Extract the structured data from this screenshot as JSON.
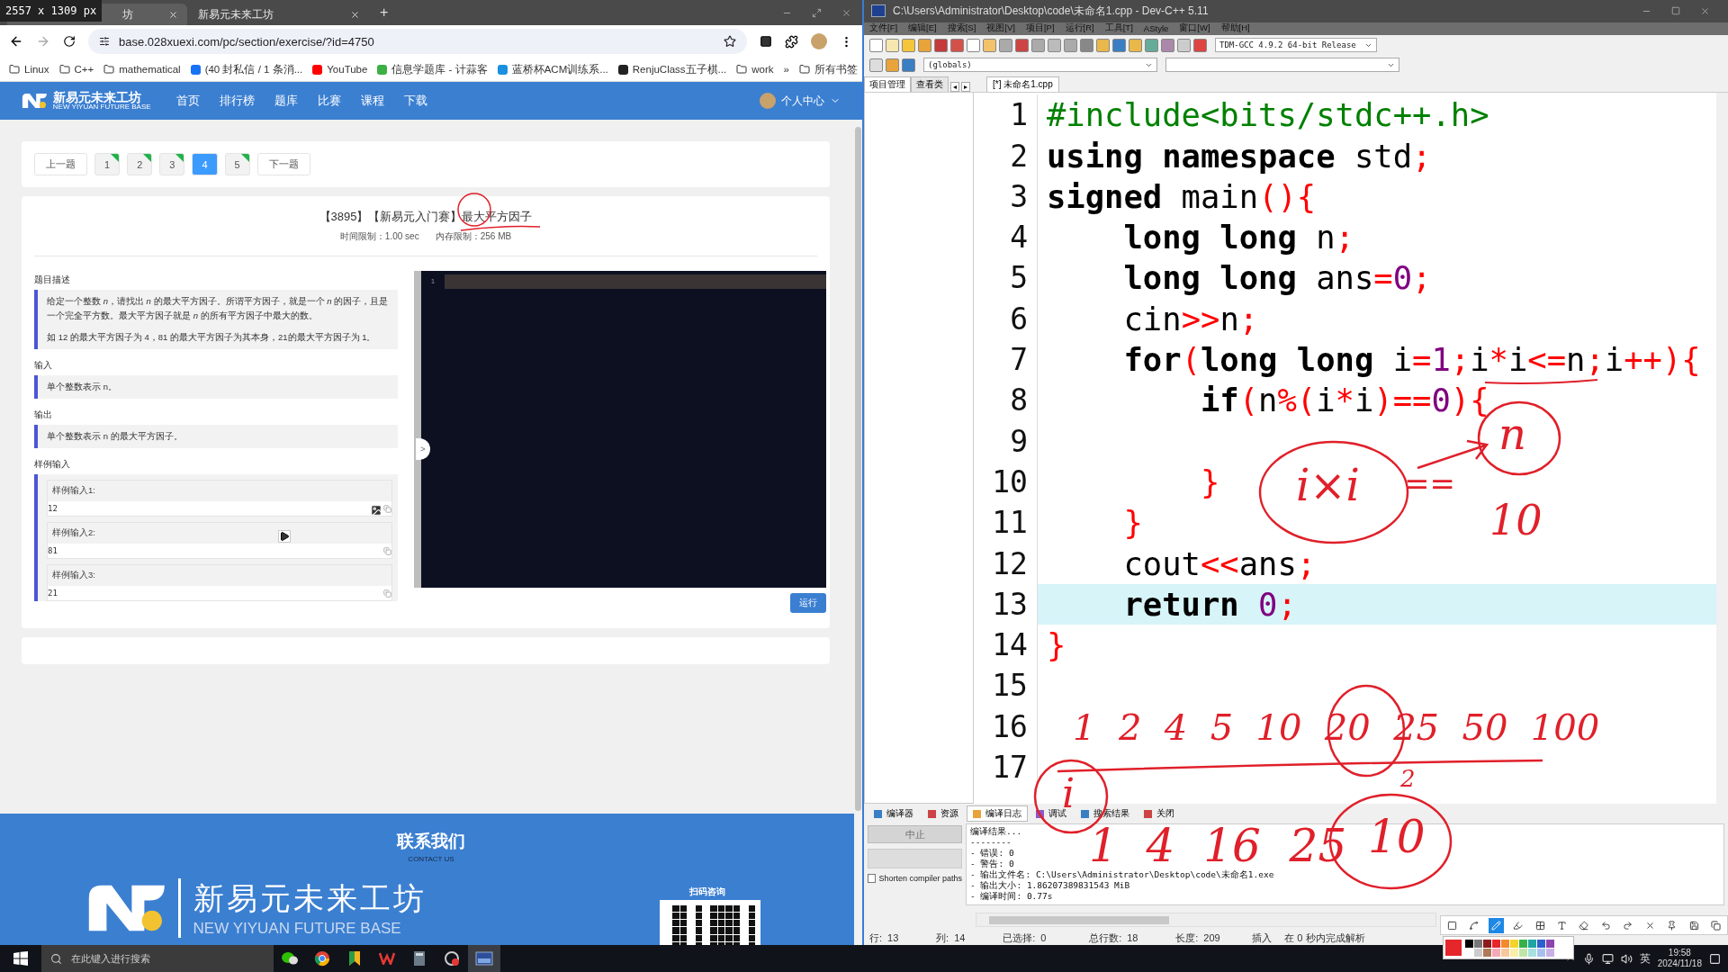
{
  "overlay_label": "2557 x 1309 px",
  "browser": {
    "tabs": [
      {
        "title": "坊",
        "selected": true
      },
      {
        "title": "新易元未来工坊",
        "selected": false
      }
    ],
    "new_tab": "+",
    "url": "base.028xuexi.com/pc/section/exercise/?id=4750",
    "bookmarks": [
      {
        "label": "Linux",
        "kind": "folder"
      },
      {
        "label": "C++",
        "kind": "folder"
      },
      {
        "label": "mathematical",
        "kind": "folder"
      },
      {
        "label": "(40 封私信 / 1 条消...",
        "kind": "zhihu"
      },
      {
        "label": "YouTube",
        "kind": "youtube"
      },
      {
        "label": "信息学题库 - 计蒜客",
        "kind": "jisuanke"
      },
      {
        "label": "蓝桥杯ACM训练系...",
        "kind": "lanqiao"
      },
      {
        "label": "RenjuClass五子棋...",
        "kind": "renju"
      },
      {
        "label": "work",
        "kind": "folder"
      }
    ],
    "bookmarks_more": "»",
    "all_bookmarks": "所有书签",
    "site": {
      "logo_title": "新易元未来工坊",
      "logo_subtitle": "NEW YIYUAN FUTURE BASE",
      "nav": [
        "首页",
        "排行榜",
        "题库",
        "比赛",
        "课程",
        "下载"
      ],
      "user": "个人中心"
    },
    "pager": {
      "prev": "上一题",
      "next": "下一题",
      "pages": [
        {
          "label": "1",
          "selected": false,
          "done": true
        },
        {
          "label": "2",
          "selected": false,
          "done": true
        },
        {
          "label": "3",
          "selected": false,
          "done": true
        },
        {
          "label": "4",
          "selected": true,
          "done": false
        },
        {
          "label": "5",
          "selected": false,
          "done": true
        }
      ]
    },
    "problem": {
      "title": "【3895】【新易元入门赛】最大平方因子",
      "meta": [
        "时间限制：1.00 sec",
        "内存限制：256 MB"
      ],
      "sections": [
        {
          "heading": "题目描述",
          "paragraphs": [
            "给定一个整数 *n*，请找出 *n* 的最大平方因子。所谓平方因子，就是一个 *n* 的因子，且是一个完全平方数。最大平方因子就是 *n* 的所有平方因子中最大的数。",
            "如 12 的最大平方因子为 4，81 的最大平方因子为其本身，21的最大平方因子为 1。"
          ]
        },
        {
          "heading": "输入",
          "paragraphs": [
            "单个整数表示 n。"
          ]
        },
        {
          "heading": "输出",
          "paragraphs": [
            "单个整数表示 n 的最大平方因子。"
          ]
        }
      ],
      "samples_heading": "样例输入",
      "samples": [
        {
          "label": "样例输入1:",
          "value": "12"
        },
        {
          "label": "样例输入2:",
          "value": "81"
        },
        {
          "label": "样例输入3:",
          "value": "21"
        }
      ]
    },
    "editor": {
      "line_numbers": [
        "1"
      ],
      "toggle": ">",
      "run": "运行"
    },
    "footer": {
      "title": "联系我们",
      "subtitle": "CONTACT US",
      "logo_title": "新易元未来工坊",
      "logo_subtitle": "NEW YIYUAN FUTURE BASE",
      "qr_label": "扫码咨询"
    }
  },
  "devcpp": {
    "title": "C:\\Users\\Administrator\\Desktop\\code\\未命名1.cpp - Dev-C++ 5.11",
    "menu": [
      "文件[F]",
      "编辑[E]",
      "搜索[S]",
      "视图[V]",
      "项目[P]",
      "运行[R]",
      "工具[T]",
      "AStyle",
      "窗口[W]",
      "帮助[H]"
    ],
    "compiler": "TDM-GCC 4.9.2 64-bit Release",
    "scope": "(globals)",
    "panel_tabs": [
      {
        "label": "项目管理",
        "selected": true
      },
      {
        "label": "查看类",
        "selected": false
      }
    ],
    "panel_arrows": [
      "◂",
      "▸"
    ],
    "file_tab": "[*] 未命名1.cpp",
    "code": [
      {
        "number": "1",
        "selected": false,
        "tokens": [
          {
            "kind": "preproc",
            "text": "#include<bits/stdc++.h>"
          }
        ]
      },
      {
        "number": "2",
        "selected": false,
        "tokens": [
          {
            "kind": "keyword",
            "text": "using namespace"
          },
          {
            "kind": "plain",
            "text": " std"
          },
          {
            "kind": "symbol",
            "text": ";"
          }
        ]
      },
      {
        "number": "3",
        "selected": false,
        "tokens": [
          {
            "kind": "keyword",
            "text": "signed"
          },
          {
            "kind": "plain",
            "text": " main"
          },
          {
            "kind": "symbol",
            "text": "(){"
          }
        ]
      },
      {
        "number": "4",
        "selected": false,
        "tokens": [
          {
            "kind": "keyword",
            "text": "    long long"
          },
          {
            "kind": "plain",
            "text": " n"
          },
          {
            "kind": "symbol",
            "text": ";"
          }
        ]
      },
      {
        "number": "5",
        "selected": false,
        "tokens": [
          {
            "kind": "keyword",
            "text": "    long long"
          },
          {
            "kind": "plain",
            "text": " ans"
          },
          {
            "kind": "symbol",
            "text": "="
          },
          {
            "kind": "number",
            "text": "0"
          },
          {
            "kind": "symbol",
            "text": ";"
          }
        ]
      },
      {
        "number": "6",
        "selected": false,
        "tokens": [
          {
            "kind": "plain",
            "text": "    cin"
          },
          {
            "kind": "symbol",
            "text": ">>"
          },
          {
            "kind": "plain",
            "text": "n"
          },
          {
            "kind": "symbol",
            "text": ";"
          }
        ]
      },
      {
        "number": "7",
        "selected": false,
        "tokens": [
          {
            "kind": "keyword",
            "text": "    for"
          },
          {
            "kind": "symbol",
            "text": "("
          },
          {
            "kind": "keyword",
            "text": "long long"
          },
          {
            "kind": "plain",
            "text": " i"
          },
          {
            "kind": "symbol",
            "text": "="
          },
          {
            "kind": "number",
            "text": "1"
          },
          {
            "kind": "symbol",
            "text": ";"
          },
          {
            "kind": "plain",
            "text": "i"
          },
          {
            "kind": "symbol",
            "text": "*"
          },
          {
            "kind": "plain",
            "text": "i"
          },
          {
            "kind": "symbol",
            "text": "<="
          },
          {
            "kind": "plain",
            "text": "n"
          },
          {
            "kind": "symbol",
            "text": ";"
          },
          {
            "kind": "plain",
            "text": "i"
          },
          {
            "kind": "symbol",
            "text": "++){"
          }
        ]
      },
      {
        "number": "8",
        "selected": false,
        "tokens": [
          {
            "kind": "keyword",
            "text": "        if"
          },
          {
            "kind": "symbol",
            "text": "("
          },
          {
            "kind": "plain",
            "text": "n"
          },
          {
            "kind": "symbol",
            "text": "%("
          },
          {
            "kind": "plain",
            "text": "i"
          },
          {
            "kind": "symbol",
            "text": "*"
          },
          {
            "kind": "plain",
            "text": "i"
          },
          {
            "kind": "symbol",
            "text": ")=="
          },
          {
            "kind": "number",
            "text": "0"
          },
          {
            "kind": "symbol",
            "text": "){"
          }
        ]
      },
      {
        "number": "9",
        "selected": false
      },
      {
        "number": "10",
        "selected": false,
        "tokens": [
          {
            "kind": "symbol",
            "text": "        }"
          }
        ]
      },
      {
        "number": "11",
        "selected": false,
        "tokens": [
          {
            "kind": "symbol",
            "text": "    }"
          }
        ]
      },
      {
        "number": "12",
        "selected": false,
        "tokens": [
          {
            "kind": "plain",
            "text": "    cout"
          },
          {
            "kind": "symbol",
            "text": "<<"
          },
          {
            "kind": "plain",
            "text": "ans"
          },
          {
            "kind": "symbol",
            "text": ";"
          }
        ]
      },
      {
        "number": "13",
        "selected": true,
        "tokens": [
          {
            "kind": "keyword",
            "text": "    return"
          },
          {
            "kind": "number",
            "text": " 0"
          },
          {
            "kind": "symbol",
            "text": ";"
          }
        ]
      },
      {
        "number": "14",
        "selected": false,
        "tokens": [
          {
            "kind": "symbol",
            "text": "}"
          }
        ]
      },
      {
        "number": "15",
        "selected": false
      },
      {
        "number": "16",
        "selected": false
      },
      {
        "number": "17",
        "selected": false
      }
    ],
    "bottom_tabs": [
      {
        "label": "编译器",
        "selected": false
      },
      {
        "label": "资源",
        "selected": false
      },
      {
        "label": "编译日志",
        "selected": true
      },
      {
        "label": "调试",
        "selected": false
      },
      {
        "label": "搜索结果",
        "selected": false
      },
      {
        "label": "关闭",
        "selected": false
      }
    ],
    "abort": "中止",
    "shorten": {
      "label": "Shorten compiler paths",
      "checked": false
    },
    "log": [
      "编译结果...",
      "--------",
      "- 错误: 0",
      "- 警告: 0",
      "- 输出文件名: C:\\Users\\Administrator\\Desktop\\code\\未命名1.exe",
      "- 输出大小: 1.86207389831543 MiB",
      "- 编译时间: 0.77s"
    ],
    "status": [
      {
        "label": "行:",
        "value": "13"
      },
      {
        "label": "列:",
        "value": "14"
      },
      {
        "label": "已选择:",
        "value": "0"
      },
      {
        "label": "总行数:",
        "value": "18"
      },
      {
        "label": "长度:",
        "value": "209"
      }
    ],
    "mode": "插入",
    "parse": "在 0 秒内完成解析"
  },
  "annotations": [
    "i×i",
    "==",
    "n",
    "10",
    "1  2  4  5  10  20  25  50  100",
    "i",
    "1  4  16  25",
    "2",
    "10"
  ],
  "taskbar": {
    "search": "在此键入进行搜索",
    "ime": "英",
    "time": "19:58",
    "date": "2024/11/18"
  }
}
